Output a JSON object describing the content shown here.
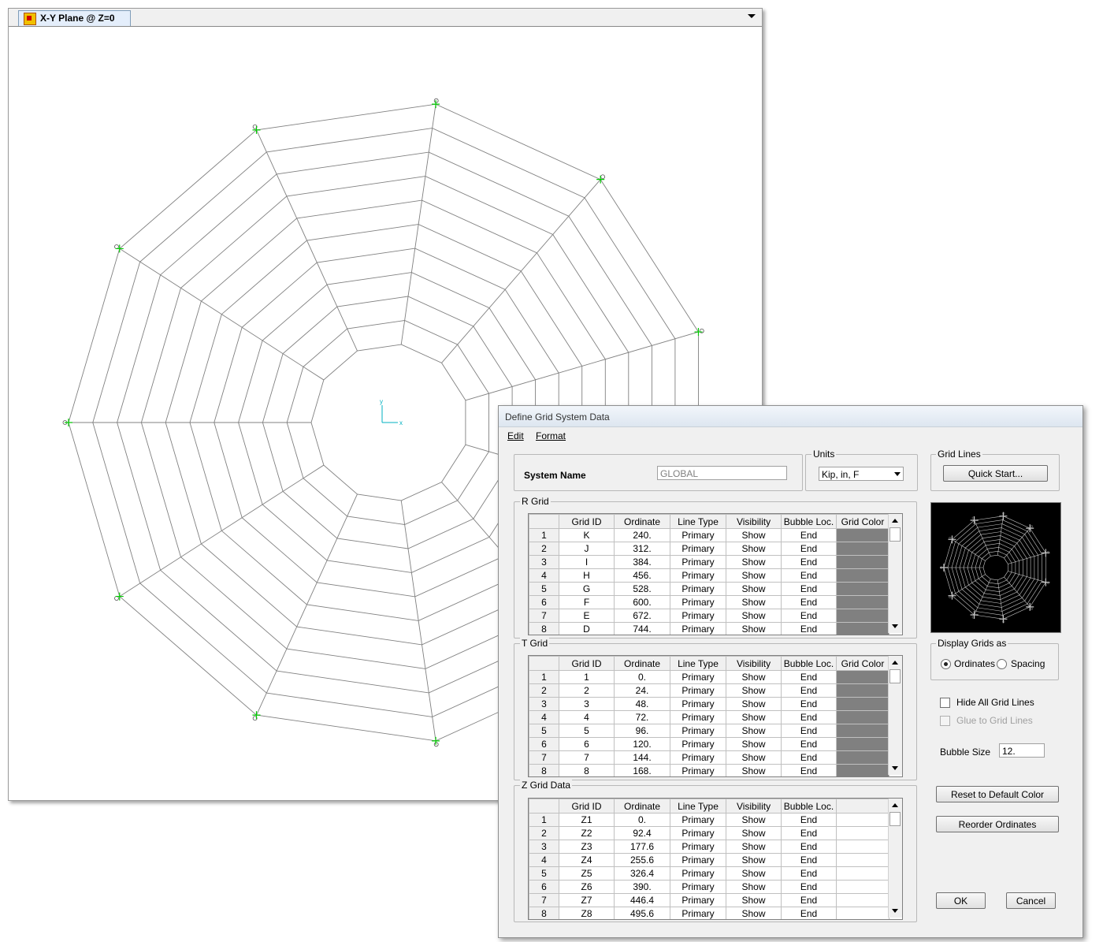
{
  "plan_window": {
    "tab_title": "X-Y Plane @ Z=0",
    "axis_x_label": "x",
    "axis_y_label": "y"
  },
  "dialog": {
    "title": "Define Grid System Data",
    "menu": {
      "edit": "Edit",
      "format": "Format"
    },
    "system_name_label": "System Name",
    "system_name_value": "GLOBAL",
    "units_label": "Units",
    "units_value": "Kip, in, F",
    "grid_lines_label": "Grid Lines",
    "quick_start_button": "Quick Start...",
    "r_grid": {
      "label": "R Grid",
      "columns": [
        "",
        "Grid ID",
        "Ordinate",
        "Line Type",
        "Visibility",
        "Bubble Loc.",
        "Grid Color"
      ],
      "rows": [
        [
          "1",
          "K",
          "240.",
          "Primary",
          "Show",
          "End"
        ],
        [
          "2",
          "J",
          "312.",
          "Primary",
          "Show",
          "End"
        ],
        [
          "3",
          "I",
          "384.",
          "Primary",
          "Show",
          "End"
        ],
        [
          "4",
          "H",
          "456.",
          "Primary",
          "Show",
          "End"
        ],
        [
          "5",
          "G",
          "528.",
          "Primary",
          "Show",
          "End"
        ],
        [
          "6",
          "F",
          "600.",
          "Primary",
          "Show",
          "End"
        ],
        [
          "7",
          "E",
          "672.",
          "Primary",
          "Show",
          "End"
        ],
        [
          "8",
          "D",
          "744.",
          "Primary",
          "Show",
          "End"
        ]
      ]
    },
    "t_grid": {
      "label": "T Grid",
      "columns": [
        "",
        "Grid ID",
        "Ordinate",
        "Line Type",
        "Visibility",
        "Bubble Loc.",
        "Grid Color"
      ],
      "rows": [
        [
          "1",
          "1",
          "0.",
          "Primary",
          "Show",
          "End"
        ],
        [
          "2",
          "2",
          "24.",
          "Primary",
          "Show",
          "End"
        ],
        [
          "3",
          "3",
          "48.",
          "Primary",
          "Show",
          "End"
        ],
        [
          "4",
          "4",
          "72.",
          "Primary",
          "Show",
          "End"
        ],
        [
          "5",
          "5",
          "96.",
          "Primary",
          "Show",
          "End"
        ],
        [
          "6",
          "6",
          "120.",
          "Primary",
          "Show",
          "End"
        ],
        [
          "7",
          "7",
          "144.",
          "Primary",
          "Show",
          "End"
        ],
        [
          "8",
          "8",
          "168.",
          "Primary",
          "Show",
          "End"
        ]
      ]
    },
    "z_grid": {
      "label": "Z Grid Data",
      "columns": [
        "",
        "Grid ID",
        "Ordinate",
        "Line Type",
        "Visibility",
        "Bubble Loc."
      ],
      "rows": [
        [
          "1",
          "Z1",
          "0.",
          "Primary",
          "Show",
          "End"
        ],
        [
          "2",
          "Z2",
          "92.4",
          "Primary",
          "Show",
          "End"
        ],
        [
          "3",
          "Z3",
          "177.6",
          "Primary",
          "Show",
          "End"
        ],
        [
          "4",
          "Z4",
          "255.6",
          "Primary",
          "Show",
          "End"
        ],
        [
          "5",
          "Z5",
          "326.4",
          "Primary",
          "Show",
          "End"
        ],
        [
          "6",
          "Z6",
          "390.",
          "Primary",
          "Show",
          "End"
        ],
        [
          "7",
          "Z7",
          "446.4",
          "Primary",
          "Show",
          "End"
        ],
        [
          "8",
          "Z8",
          "495.6",
          "Primary",
          "Show",
          "End"
        ]
      ]
    },
    "display_grids_label": "Display Grids as",
    "ordinates_label": "Ordinates",
    "spacing_label": "Spacing",
    "display_mode": "Ordinates",
    "hide_all_label": "Hide All Grid Lines",
    "hide_all_checked": false,
    "glue_label": "Glue to Grid Lines",
    "glue_checked": false,
    "bubble_size_label": "Bubble Size",
    "bubble_size_value": "12.",
    "reset_color_button": "Reset to Default Color",
    "reorder_button": "Reorder Ordinates",
    "ok_button": "OK",
    "cancel_button": "Cancel"
  },
  "colors": {
    "grid_line": "#808080",
    "bubble_marker": "#00cc00",
    "axis": "#00b0c0",
    "grid_color_swatch": "#808080",
    "preview_background": "#000000"
  }
}
